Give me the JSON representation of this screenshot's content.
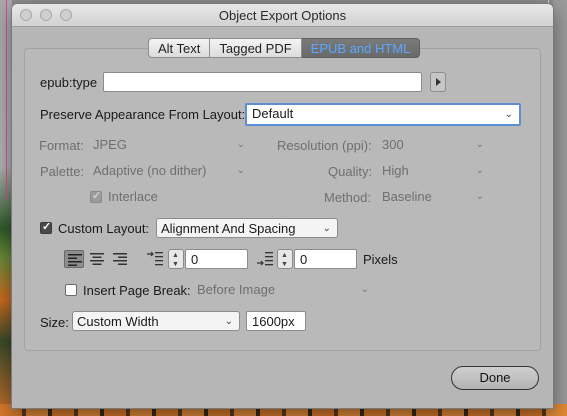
{
  "window": {
    "title": "Object Export Options"
  },
  "tabs": [
    {
      "label": "Alt Text",
      "active": false
    },
    {
      "label": "Tagged PDF",
      "active": false
    },
    {
      "label": "EPUB and HTML",
      "active": true
    }
  ],
  "epub": {
    "type_label": "epub:type",
    "type_value": "",
    "preserve_label": "Preserve Appearance From Layout:",
    "preserve_value": "Default"
  },
  "format": {
    "label": "Format:",
    "value": "JPEG"
  },
  "resolution": {
    "label": "Resolution (ppi):",
    "value": "300"
  },
  "palette": {
    "label": "Palette:",
    "value": "Adaptive (no dither)"
  },
  "quality": {
    "label": "Quality:",
    "value": "High"
  },
  "interlace": {
    "label": "Interlace",
    "checked": true,
    "enabled": false
  },
  "method": {
    "label": "Method:",
    "value": "Baseline"
  },
  "custom_layout": {
    "label": "Custom Layout:",
    "checked": true,
    "value": "Alignment And Spacing"
  },
  "spacing": {
    "before_value": "0",
    "after_value": "0",
    "unit": "Pixels"
  },
  "page_break": {
    "label": "Insert Page Break:",
    "checked": false,
    "value": "Before Image"
  },
  "size": {
    "label": "Size:",
    "value": "Custom Width",
    "width_value": "1600px"
  },
  "buttons": {
    "done": "Done"
  },
  "colors": {
    "active_tab_text": "#5aa8ff",
    "focus_ring": "#5c8fd6"
  }
}
